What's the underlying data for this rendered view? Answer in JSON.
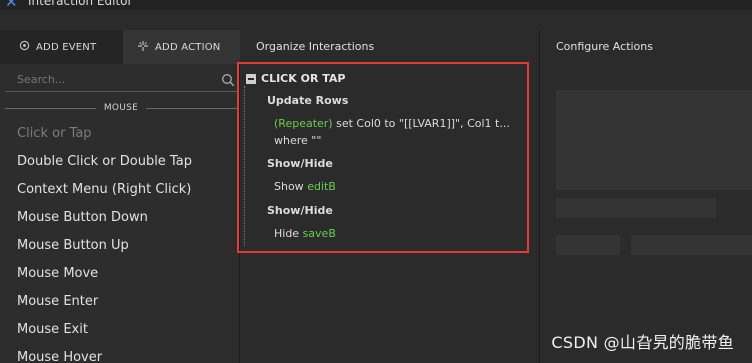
{
  "window": {
    "title": "Interaction Editor"
  },
  "left_panel": {
    "tabs": {
      "add_event": "ADD EVENT",
      "add_action": "ADD ACTION"
    },
    "search_placeholder": "Search...",
    "section_label": "MOUSE",
    "events": [
      {
        "label": "Click or Tap",
        "disabled": true
      },
      {
        "label": "Double Click or Double Tap"
      },
      {
        "label": "Context Menu (Right Click)"
      },
      {
        "label": "Mouse Button Down"
      },
      {
        "label": "Mouse Button Up"
      },
      {
        "label": "Mouse Move"
      },
      {
        "label": "Mouse Enter"
      },
      {
        "label": "Mouse Exit"
      },
      {
        "label": "Mouse Hover"
      }
    ]
  },
  "organize": {
    "header": "Organize Interactions",
    "trigger": "CLICK OR TAP",
    "actions": [
      {
        "title": "Update Rows",
        "target": "(Repeater)",
        "text": "set Col0 to \"[[LVAR1]]\", Col1 t...",
        "text2": "where \"\""
      },
      {
        "title": "Show/Hide",
        "verb": "Show",
        "target": "editB"
      },
      {
        "title": "Show/Hide",
        "verb": "Hide",
        "target": "saveB"
      }
    ]
  },
  "configure": {
    "header": "Configure Actions"
  },
  "watermark": "CSDN @山旮旯的脆带鱼",
  "colors": {
    "highlight_border": "#e53935",
    "target_green": "#6acd4f",
    "logo_blue": "#4a8df0"
  }
}
